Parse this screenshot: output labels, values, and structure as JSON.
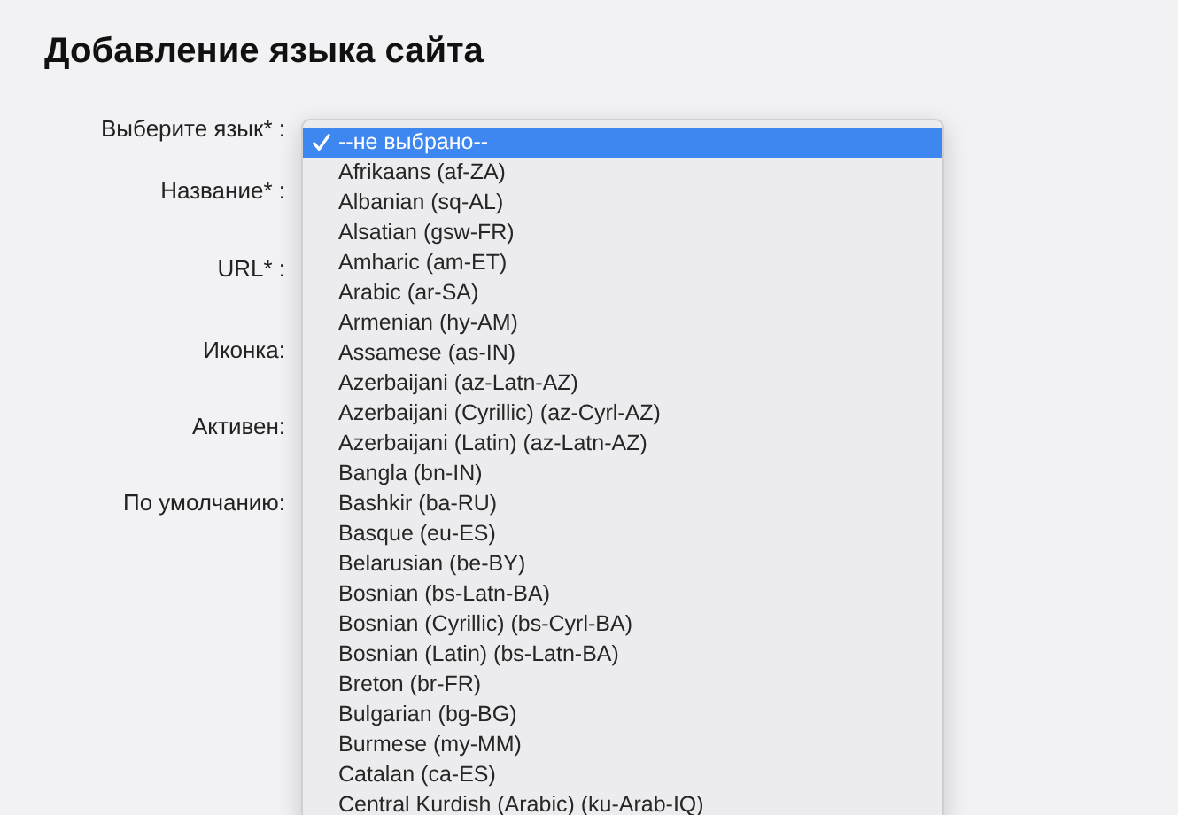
{
  "title": "Добавление языка сайта",
  "form": {
    "labels": [
      "Выберите язык* :",
      "Название* :",
      "URL* :",
      "Иконка:",
      "Активен:",
      "По умолчанию:"
    ]
  },
  "dropdown": {
    "options": [
      {
        "label": "--не выбрано--",
        "selected": true
      },
      {
        "label": "Afrikaans (af-ZA)",
        "selected": false
      },
      {
        "label": "Albanian (sq-AL)",
        "selected": false
      },
      {
        "label": "Alsatian (gsw-FR)",
        "selected": false
      },
      {
        "label": "Amharic (am-ET)",
        "selected": false
      },
      {
        "label": "Arabic (ar-SA)",
        "selected": false
      },
      {
        "label": "Armenian (hy-AM)",
        "selected": false
      },
      {
        "label": "Assamese (as-IN)",
        "selected": false
      },
      {
        "label": "Azerbaijani (az-Latn-AZ)",
        "selected": false
      },
      {
        "label": "Azerbaijani (Cyrillic) (az-Cyrl-AZ)",
        "selected": false
      },
      {
        "label": "Azerbaijani (Latin) (az-Latn-AZ)",
        "selected": false
      },
      {
        "label": "Bangla (bn-IN)",
        "selected": false
      },
      {
        "label": "Bashkir (ba-RU)",
        "selected": false
      },
      {
        "label": "Basque (eu-ES)",
        "selected": false
      },
      {
        "label": "Belarusian (be-BY)",
        "selected": false
      },
      {
        "label": "Bosnian (bs-Latn-BA)",
        "selected": false
      },
      {
        "label": "Bosnian (Cyrillic) (bs-Cyrl-BA)",
        "selected": false
      },
      {
        "label": "Bosnian (Latin) (bs-Latn-BA)",
        "selected": false
      },
      {
        "label": "Breton (br-FR)",
        "selected": false
      },
      {
        "label": "Bulgarian (bg-BG)",
        "selected": false
      },
      {
        "label": "Burmese (my-MM)",
        "selected": false
      },
      {
        "label": "Catalan (ca-ES)",
        "selected": false
      },
      {
        "label": "Central Kurdish (Arabic) (ku-Arab-IQ)",
        "selected": false
      }
    ]
  }
}
